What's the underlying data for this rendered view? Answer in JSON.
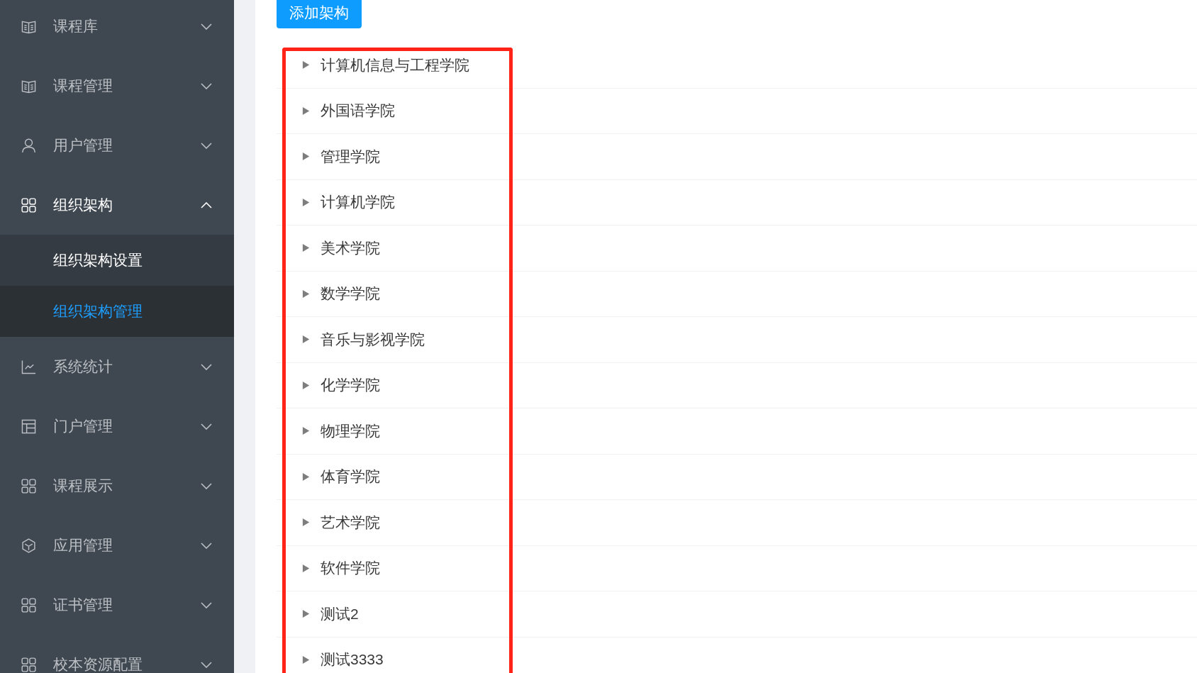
{
  "sidebar": {
    "items": [
      {
        "label": "课程库",
        "kind": "book",
        "expanded": false
      },
      {
        "label": "课程管理",
        "kind": "book",
        "expanded": false
      },
      {
        "label": "用户管理",
        "kind": "user",
        "expanded": false
      },
      {
        "label": "组织架构",
        "kind": "grid",
        "expanded": true,
        "children": [
          {
            "label": "组织架构设置",
            "selected": false
          },
          {
            "label": "组织架构管理",
            "selected": true
          }
        ]
      },
      {
        "label": "系统统计",
        "kind": "chart",
        "expanded": false
      },
      {
        "label": "门户管理",
        "kind": "layout",
        "expanded": false
      },
      {
        "label": "课程展示",
        "kind": "grid",
        "expanded": false
      },
      {
        "label": "应用管理",
        "kind": "cube",
        "expanded": false
      },
      {
        "label": "证书管理",
        "kind": "grid",
        "expanded": false
      },
      {
        "label": "校本资源配置",
        "kind": "grid",
        "expanded": false
      }
    ]
  },
  "add_button": "添加架构",
  "tree": {
    "highlighted": true,
    "nodes": [
      {
        "label": "计算机信息与工程学院",
        "expanded": false
      },
      {
        "label": "外国语学院",
        "expanded": false
      },
      {
        "label": "管理学院",
        "expanded": false
      },
      {
        "label": "计算机学院",
        "expanded": false
      },
      {
        "label": "美术学院",
        "expanded": false
      },
      {
        "label": "数学学院",
        "expanded": false
      },
      {
        "label": "音乐与影视学院",
        "expanded": false
      },
      {
        "label": "化学学院",
        "expanded": false
      },
      {
        "label": "物理学院",
        "expanded": false
      },
      {
        "label": "体育学院",
        "expanded": false
      },
      {
        "label": "艺术学院",
        "expanded": false
      },
      {
        "label": "软件学院",
        "expanded": false
      },
      {
        "label": "测试2",
        "expanded": false
      },
      {
        "label": "测试3333",
        "expanded": false
      }
    ]
  }
}
